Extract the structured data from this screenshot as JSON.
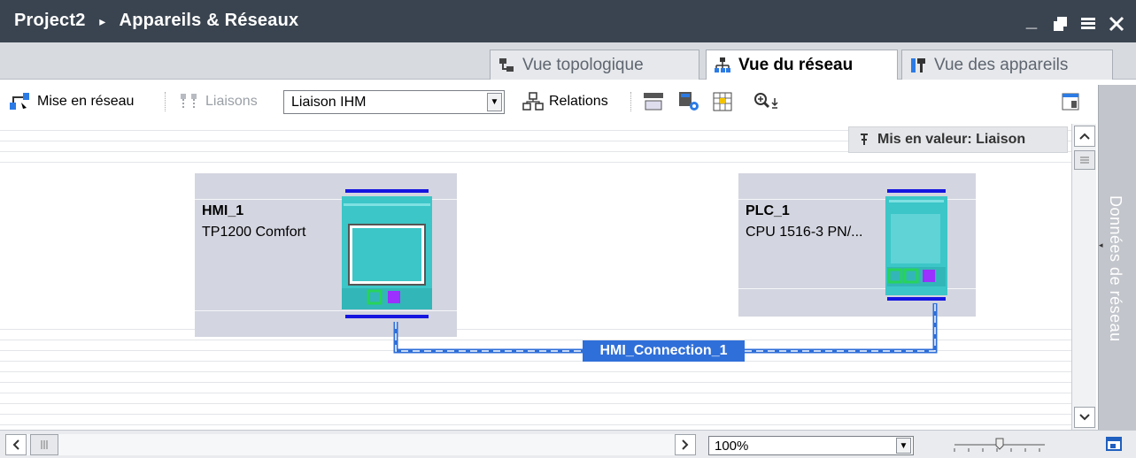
{
  "window": {
    "title": "Project2",
    "breadcrumb_sep": "▸",
    "section": "Appareils & Réseaux",
    "minimize_glyph": "_",
    "float_glyph": "▪",
    "maximize_glyph": "▬",
    "close_glyph": "✕"
  },
  "tabs": [
    {
      "label": "Vue topologique",
      "icon": "topology-icon",
      "active": false
    },
    {
      "label": "Vue du réseau",
      "icon": "network-icon",
      "active": true
    },
    {
      "label": "Vue des appareils",
      "icon": "device-icon",
      "active": false
    }
  ],
  "toolbar": {
    "network_label": "Mise en réseau",
    "connections_label": "Liaisons",
    "connection_type": "Liaison IHM",
    "relations_label": "Relations"
  },
  "canvas": {
    "highlight_label": "Mis en valeur: Liaison",
    "devices": [
      {
        "name": "HMI_1",
        "type": "TP1200 Comfort"
      },
      {
        "name": "PLC_1",
        "type": "CPU 1516-3 PN/..."
      }
    ],
    "connection_label": "HMI_Connection_1"
  },
  "side_panel": {
    "label": "Données de réseau"
  },
  "footer": {
    "zoom": "100%"
  },
  "colors": {
    "titlebar": "#3a4450",
    "device_bg": "#d3d5e0",
    "connection": "#2f6fd9",
    "device_teal": "#3cc6c8",
    "port_green": "#27d35a",
    "port_purple": "#9b30ff",
    "bus_blue": "#1515e0"
  }
}
